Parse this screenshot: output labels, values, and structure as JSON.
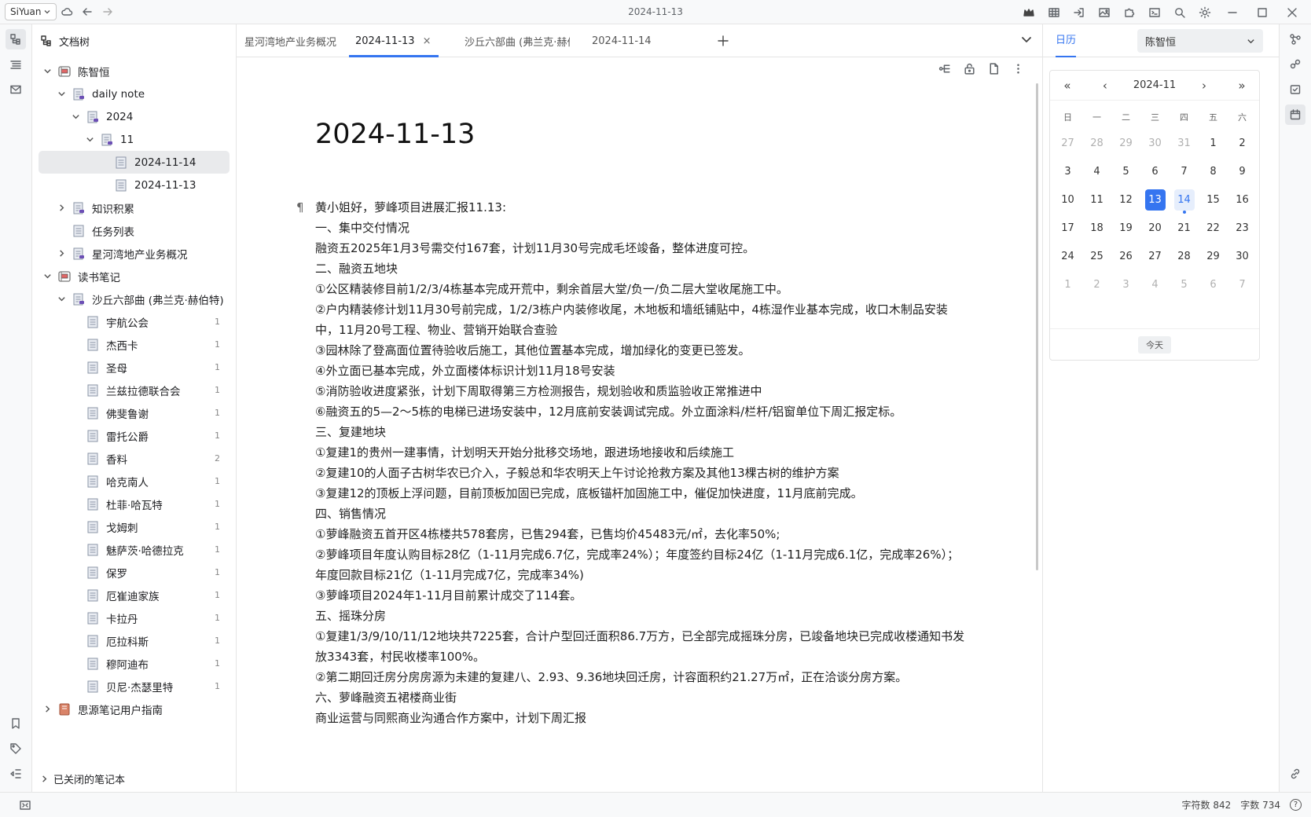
{
  "app": {
    "brand": "SiYuan",
    "window_title": "2024-11-13"
  },
  "filetree": {
    "title": "文档树",
    "items": [
      {
        "label": "陈智恒",
        "level": 0,
        "arrow": "open",
        "icon": "notebook"
      },
      {
        "label": "daily note",
        "level": 1,
        "arrow": "open",
        "icon": "doc-stack"
      },
      {
        "label": "2024",
        "level": 2,
        "arrow": "open",
        "icon": "doc-stack"
      },
      {
        "label": "11",
        "level": 3,
        "arrow": "open",
        "icon": "doc-stack"
      },
      {
        "label": "2024-11-14",
        "level": 4,
        "arrow": "none",
        "icon": "doc",
        "selected": true
      },
      {
        "label": "2024-11-13",
        "level": 4,
        "arrow": "none",
        "icon": "doc"
      },
      {
        "label": "知识积累",
        "level": 1,
        "arrow": "closed",
        "icon": "doc-stack"
      },
      {
        "label": "任务列表",
        "level": 1,
        "arrow": "none",
        "icon": "doc"
      },
      {
        "label": "星河湾地产业务概况",
        "level": 1,
        "arrow": "closed",
        "icon": "doc-stack"
      },
      {
        "label": "读书笔记",
        "level": 0,
        "arrow": "open",
        "icon": "notebook"
      },
      {
        "label": "沙丘六部曲 (弗兰克·赫伯特)",
        "level": 1,
        "arrow": "open",
        "icon": "doc-stack"
      },
      {
        "label": "宇航公会",
        "level": 2,
        "arrow": "none",
        "icon": "doc",
        "count": "1"
      },
      {
        "label": "杰西卡",
        "level": 2,
        "arrow": "none",
        "icon": "doc",
        "count": "1"
      },
      {
        "label": "圣母",
        "level": 2,
        "arrow": "none",
        "icon": "doc",
        "count": "1"
      },
      {
        "label": "兰兹拉德联合会",
        "level": 2,
        "arrow": "none",
        "icon": "doc",
        "count": "1"
      },
      {
        "label": "佛斐鲁谢",
        "level": 2,
        "arrow": "none",
        "icon": "doc",
        "count": "1"
      },
      {
        "label": "雷托公爵",
        "level": 2,
        "arrow": "none",
        "icon": "doc",
        "count": "1"
      },
      {
        "label": "香料",
        "level": 2,
        "arrow": "none",
        "icon": "doc",
        "count": "2"
      },
      {
        "label": "哈克南人",
        "level": 2,
        "arrow": "none",
        "icon": "doc",
        "count": "1"
      },
      {
        "label": "杜菲·哈瓦特",
        "level": 2,
        "arrow": "none",
        "icon": "doc",
        "count": "1"
      },
      {
        "label": "戈姆刺",
        "level": 2,
        "arrow": "none",
        "icon": "doc",
        "count": "1"
      },
      {
        "label": "魅萨茨·哈德拉克",
        "level": 2,
        "arrow": "none",
        "icon": "doc",
        "count": "1"
      },
      {
        "label": "保罗",
        "level": 2,
        "arrow": "none",
        "icon": "doc",
        "count": "1"
      },
      {
        "label": "厄崔迪家族",
        "level": 2,
        "arrow": "none",
        "icon": "doc",
        "count": "1"
      },
      {
        "label": "卡拉丹",
        "level": 2,
        "arrow": "none",
        "icon": "doc",
        "count": "1"
      },
      {
        "label": "厄拉科斯",
        "level": 2,
        "arrow": "none",
        "icon": "doc",
        "count": "1"
      },
      {
        "label": "穆阿迪布",
        "level": 2,
        "arrow": "none",
        "icon": "doc",
        "count": "1"
      },
      {
        "label": "贝尼·杰瑟里特",
        "level": 2,
        "arrow": "none",
        "icon": "doc",
        "count": "1"
      },
      {
        "label": "思源笔记用户指南",
        "level": 0,
        "arrow": "closed",
        "icon": "book"
      }
    ],
    "closed_notebooks": "已关闭的笔记本"
  },
  "tabs": [
    {
      "label": "星河湾地产业务概况",
      "active": false
    },
    {
      "label": "2024-11-13",
      "active": true,
      "close": "×"
    },
    {
      "label": "沙丘六部曲 (弗兰克·赫伯",
      "active": false
    },
    {
      "label": "2024-11-14",
      "active": false
    }
  ],
  "document": {
    "title": "2024-11-13",
    "pilcrow": "¶",
    "paragraphs": [
      "黄小姐好，萝峰项目进展汇报11.13:",
      "一、集中交付情况",
      "融资五2025年1月3号需交付167套，计划11月30号完成毛坯竣备，整体进度可控。",
      "二、融资五地块",
      "①公区精装修目前1/2/3/4栋基本完成开荒中，剩余首层大堂/负一/负二层大堂收尾施工中。",
      "②户内精装修计划11月30号前完成，1/2/3栋户内装修收尾，木地板和墙纸铺贴中，4栋湿作业基本完成，收口木制品安装中，11月20号工程、物业、营销开始联合查验",
      "③园林除了登高面位置待验收后施工，其他位置基本完成，增加绿化的变更已签发。",
      "④外立面已基本完成，外立面楼体标识计划11月18号安装",
      "⑤消防验收进度紧张，计划下周取得第三方检测报告，规划验收和质监验收正常推进中",
      "⑥融资五的5—2～5栋的电梯已进场安装中，12月底前安装调试完成。外立面涂料/栏杆/铝窗单位下周汇报定标。",
      "三、复建地块",
      "①复建1的贵州一建事情，计划明天开始分批移交场地，跟进场地接收和后续施工",
      "②复建10的人面子古树华农已介入，子毅总和华农明天上午讨论抢救方案及其他13棵古树的维护方案",
      "③复建12的顶板上浮问题，目前顶板加固已完成，底板锚杆加固施工中，催促加快进度，11月底前完成。",
      "四、销售情况",
      "①萝峰融资五首开区4栋楼共578套房，已售294套，已售均价45483元/㎡，去化率50%;",
      "②萝峰项目年度认购目标28亿（1-11月完成6.7亿，完成率24%）；年度签约目标24亿（1-11月完成6.1亿，完成率26%）；年度回款目标21亿（1-11月完成7亿，完成率34%)",
      "③萝峰项目2024年1-11月目前累计成交了114套。",
      "五、摇珠分房",
      "①复建1/3/9/10/11/12地块共7225套，合计户型回迁面积86.7万方，已全部完成摇珠分房，已竣备地块已完成收楼通知书发放3343套，村民收楼率100%。",
      "②第二期回迁房分房房源为未建的复建八、2.93、9.36地块回迁房，计容面积约21.27万㎡，正在洽谈分房方案。",
      "六、萝峰融资五裙楼商业街",
      "商业运营与同熙商业沟通合作方案中，计划下周汇报"
    ]
  },
  "calendar": {
    "tab_label": "日历",
    "notebook_select": "陈智恒",
    "month_label": "2024-11",
    "nav": {
      "prev_year": "«",
      "prev_month": "‹",
      "next_month": "›",
      "next_year": "»"
    },
    "weekdays": [
      "日",
      "一",
      "二",
      "三",
      "四",
      "五",
      "六"
    ],
    "days": [
      {
        "d": "27",
        "other": true
      },
      {
        "d": "28",
        "other": true
      },
      {
        "d": "29",
        "other": true
      },
      {
        "d": "30",
        "other": true
      },
      {
        "d": "31",
        "other": true
      },
      {
        "d": "1"
      },
      {
        "d": "2"
      },
      {
        "d": "3"
      },
      {
        "d": "4"
      },
      {
        "d": "5"
      },
      {
        "d": "6"
      },
      {
        "d": "7"
      },
      {
        "d": "8"
      },
      {
        "d": "9"
      },
      {
        "d": "10"
      },
      {
        "d": "11"
      },
      {
        "d": "12"
      },
      {
        "d": "13",
        "today": true
      },
      {
        "d": "14",
        "selected": true,
        "dot": true
      },
      {
        "d": "15"
      },
      {
        "d": "16"
      },
      {
        "d": "17"
      },
      {
        "d": "18"
      },
      {
        "d": "19"
      },
      {
        "d": "20"
      },
      {
        "d": "21"
      },
      {
        "d": "22"
      },
      {
        "d": "23"
      },
      {
        "d": "24"
      },
      {
        "d": "25"
      },
      {
        "d": "26"
      },
      {
        "d": "27"
      },
      {
        "d": "28"
      },
      {
        "d": "29"
      },
      {
        "d": "30"
      },
      {
        "d": "1",
        "other": true
      },
      {
        "d": "2",
        "other": true
      },
      {
        "d": "3",
        "other": true
      },
      {
        "d": "4",
        "other": true
      },
      {
        "d": "5",
        "other": true
      },
      {
        "d": "6",
        "other": true
      },
      {
        "d": "7",
        "other": true
      }
    ],
    "today_button": "今天"
  },
  "status": {
    "char_count": "字符数 842",
    "word_count": "字数 734",
    "help": "?"
  },
  "colors": {
    "accent": "#3575f0",
    "notebook_icon": "#d9534f",
    "doc_icon": "#8a94a6"
  }
}
